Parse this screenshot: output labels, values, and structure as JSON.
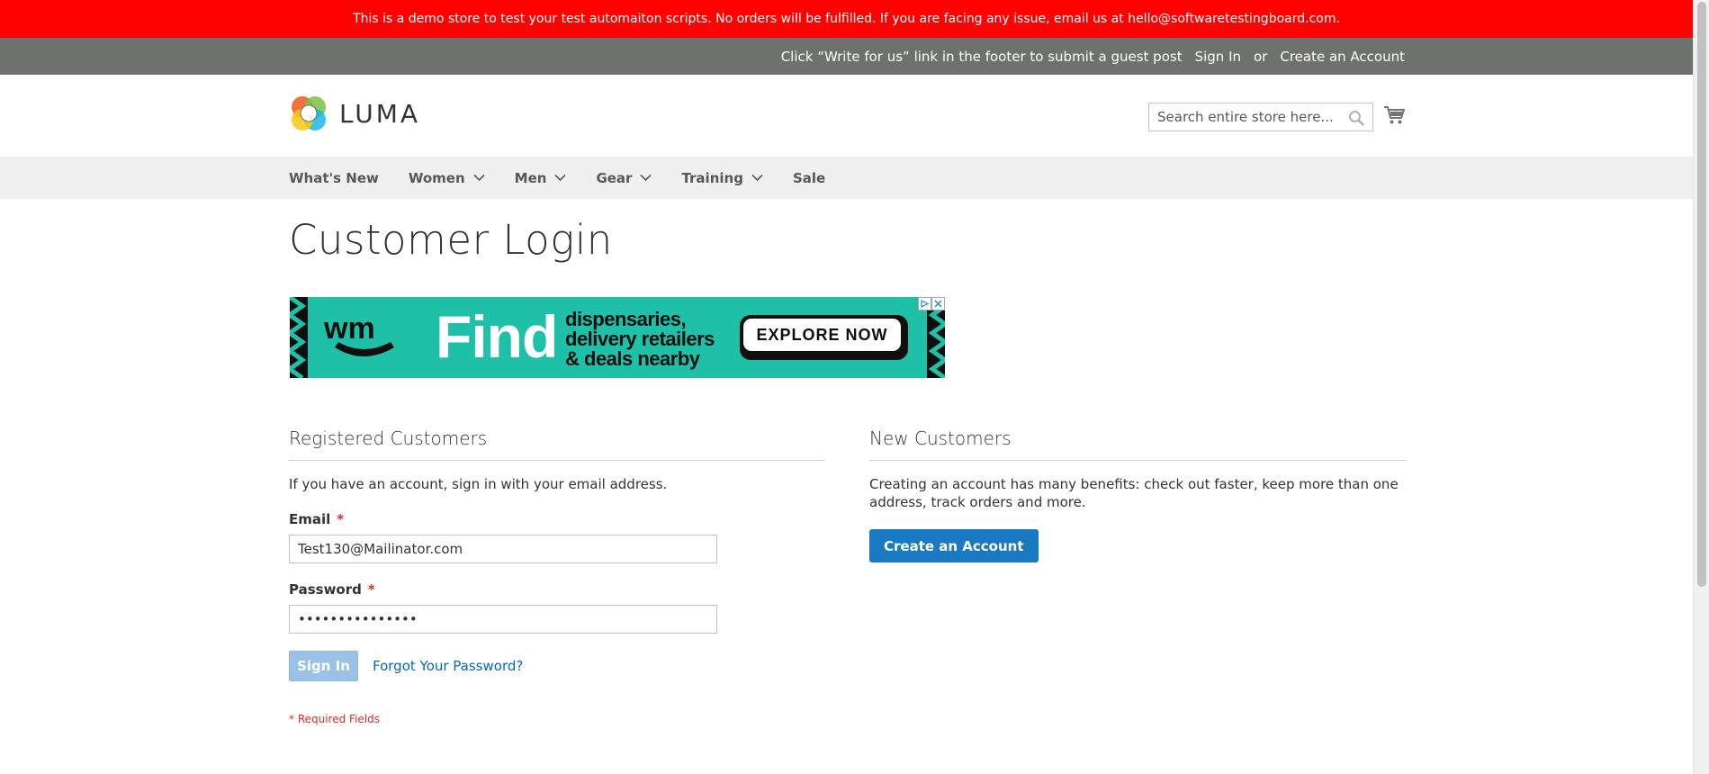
{
  "demo_banner": "This is a demo store to test your test automaiton scripts. No orders will be fulfilled. If you are facing any issue, email us at hello@softwaretestingboard.com.",
  "panel_header": {
    "promo": "Click “Write for us” link in the footer to submit a guest post",
    "sign_in": "Sign In",
    "or": "or",
    "create_account": "Create an Account"
  },
  "header": {
    "logo_text": "LUMA",
    "search_placeholder": "Search entire store here...",
    "search_icon": "search-icon",
    "cart_icon": "cart-icon"
  },
  "nav": {
    "items": [
      {
        "label": "What's New",
        "has_dropdown": false
      },
      {
        "label": "Women",
        "has_dropdown": true
      },
      {
        "label": "Men",
        "has_dropdown": true
      },
      {
        "label": "Gear",
        "has_dropdown": true
      },
      {
        "label": "Training",
        "has_dropdown": true
      },
      {
        "label": "Sale",
        "has_dropdown": false
      }
    ]
  },
  "page_title": "Customer Login",
  "ad": {
    "brand": "wm",
    "headline": "Find",
    "subline_1": "dispensaries,",
    "subline_2": "delivery retailers",
    "subline_3": "& deals nearby",
    "cta": "EXPLORE NOW",
    "color": "#1ec0a8"
  },
  "registered": {
    "title": "Registered Customers",
    "intro": "If you have an account, sign in with your email address.",
    "email_label": "Email",
    "email_value": "Test130@Mailinator.com",
    "password_label": "Password",
    "password_value": "•••••••••••••••",
    "required_mark": "*",
    "sign_in_button": "Sign In",
    "forgot_link": "Forgot Your Password?",
    "required_note": "* Required Fields"
  },
  "new_customers": {
    "title": "New Customers",
    "text": "Creating an account has many benefits: check out faster, keep more than one address, track orders and more.",
    "create_button": "Create an Account"
  },
  "colors": {
    "banner": "#ff0101",
    "panel": "#6e716e",
    "primary": "#1979c3",
    "link": "#006bb4",
    "required": "#e02b27"
  }
}
